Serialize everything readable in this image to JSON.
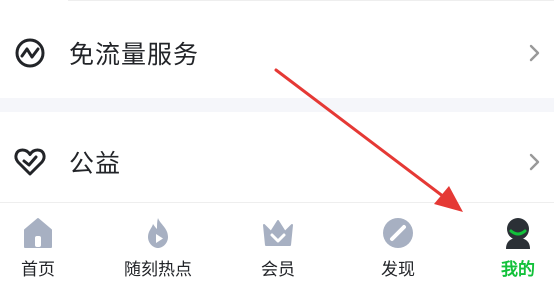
{
  "menu": {
    "items": [
      {
        "label": "免流量服务",
        "icon": "flow-service-icon"
      },
      {
        "label": "公益",
        "icon": "charity-heart-icon"
      }
    ]
  },
  "tabbar": {
    "tabs": [
      {
        "label": "首页",
        "icon": "home-icon",
        "active": false
      },
      {
        "label": "随刻热点",
        "icon": "flame-icon",
        "active": false
      },
      {
        "label": "会员",
        "icon": "crown-icon",
        "active": false
      },
      {
        "label": "发现",
        "icon": "compass-icon",
        "active": false
      },
      {
        "label": "我的",
        "icon": "avatar-icon",
        "active": true
      }
    ]
  },
  "colors": {
    "text": "#222428",
    "icon_gray": "#a7b0c2",
    "active_green": "#12c13a",
    "avatar_dark": "#2b3036",
    "annotation_red": "#e53935",
    "band": "#f5f6fa"
  }
}
